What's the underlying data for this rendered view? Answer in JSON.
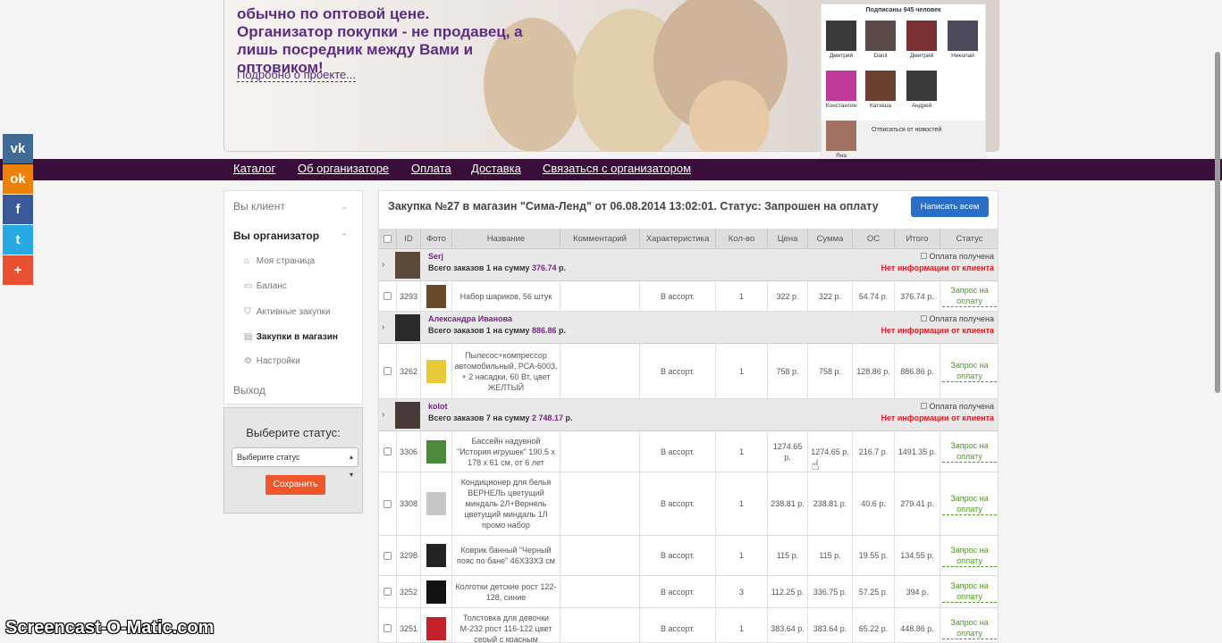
{
  "hero": {
    "text": "обычно по оптовой цене. Организатор покупки - не продавец, а лишь посредник между Вами и оптовиком!",
    "link": "Подробно о проекте..."
  },
  "subscribers": {
    "title": "Подписаны 945 человек",
    "people": [
      "Дмитрий",
      "Danil",
      "Дмитрий",
      "Николай",
      "Константин",
      "Катюша",
      "Андрей",
      "Яна"
    ],
    "unsubscribe": "Отписаться от новостей"
  },
  "nav": [
    "Каталог",
    "Об организаторе",
    "Оплата",
    "Доставка",
    "Связаться с организатором"
  ],
  "social": [
    "vk",
    "ok",
    "f",
    "t",
    "+"
  ],
  "sidebar": {
    "client": "Вы клиент",
    "organizer": "Вы организатор",
    "items": [
      "Моя страница",
      "Баланс",
      "Активные закупки",
      "Закупки в магазин",
      "Настройки"
    ],
    "logout": "Выход"
  },
  "status_box": {
    "label": "Выберите статус:",
    "select": "Выберите статус",
    "save": "Сохранить"
  },
  "panel": {
    "title": "Закупка №27 в магазин \"Сима-Ленд\" от 06.08.2014 13:02:01. Статус: Запрошен на оплату",
    "write_all": "Написать всем"
  },
  "columns": [
    "ID",
    "Фото",
    "Название",
    "Комментарий",
    "Характеристика",
    "Кол-во",
    "Цена",
    "Сумма",
    "ОС",
    "Итого",
    "Статус"
  ],
  "groups": [
    {
      "name": "Serj",
      "total_prefix": "Всего заказов 1 на сумму",
      "total_sum": "376.74",
      "total_suffix": "р.",
      "paid": "Оплата получена",
      "noinfo": "Нет информации от клиента",
      "rows": [
        {
          "id": "3293",
          "name": "Набор шариков, 56 штук",
          "char": "В ассорт.",
          "qty": "1",
          "price": "322 р.",
          "sum": "322 р.",
          "os": "54.74 р.",
          "total": "376.74 р.",
          "status": "Запрос на оплату"
        }
      ]
    },
    {
      "name": "Александра Иванова",
      "total_prefix": "Всего заказов 1 на сумму",
      "total_sum": "886.86",
      "total_suffix": "р.",
      "paid": "Оплата получена",
      "noinfo": "Нет информации от клиента",
      "rows": [
        {
          "id": "3262",
          "name": "Пылесос+компрессор автомобильный, РСА-6003, + 2 насадки, 60 Вт, цвет ЖЕЛТЫЙ",
          "char": "В ассорт.",
          "qty": "1",
          "price": "758 р.",
          "sum": "758 р.",
          "os": "128.86 р.",
          "total": "886.86 р.",
          "status": "Запрос на оплату"
        }
      ]
    },
    {
      "name": "kolot",
      "total_prefix": "Всего заказов 7 на сумму",
      "total_sum": "2 748.17",
      "total_suffix": "р.",
      "paid": "Оплата получена",
      "noinfo": "Нет информации от клиента",
      "rows": [
        {
          "id": "3306",
          "name": "Бассейн надувной \"История игрушек\" 190.5 x 178 x 61 см, от 6 лет",
          "char": "В ассорт.",
          "qty": "1",
          "price": "1274.65 р.",
          "sum": "1274.65 р.",
          "os": "216.7 р.",
          "total": "1491.35 р.",
          "status": "Запрос на оплату"
        },
        {
          "id": "3308",
          "name": "Кондиционер для белья ВЕРНЕЛЬ цветущий миндаль 2Л+Вернель цветущий миндаль 1Л промо набор",
          "char": "В ассорт.",
          "qty": "1",
          "price": "238.81 р.",
          "sum": "238.81 р.",
          "os": "40.6 р.",
          "total": "279.41 р.",
          "status": "Запрос на оплату"
        },
        {
          "id": "3298",
          "name": "Коврик банный \"Черный пояс по бане\" 46X33X3 см",
          "char": "В ассорт.",
          "qty": "1",
          "price": "115 р.",
          "sum": "115 р.",
          "os": "19.55 р.",
          "total": "134.55 р.",
          "status": "Запрос на оплату"
        },
        {
          "id": "3252",
          "name": "Колготки детские рост 122-128, синие",
          "char": "В ассорт.",
          "qty": "3",
          "price": "112.25 р.",
          "sum": "336.75 р.",
          "os": "57.25 р.",
          "total": "394 р.",
          "status": "Запрос на оплату"
        },
        {
          "id": "3251",
          "name": "Толстовка для девочки М-232 рост 116-122 цвет серый с красным",
          "char": "В ассорт.",
          "qty": "1",
          "price": "383.64 р.",
          "sum": "383.64 р.",
          "os": "65.22 р.",
          "total": "448.86 р.",
          "status": "Запрос на оплату"
        }
      ]
    }
  ],
  "watermark": "Screencast-O-Matic.com"
}
